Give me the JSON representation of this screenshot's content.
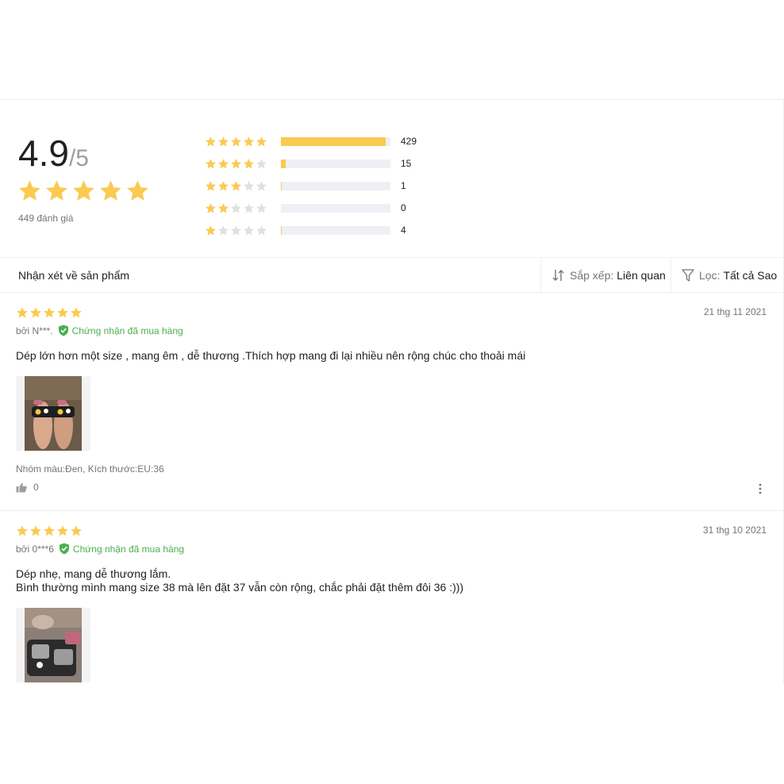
{
  "summary": {
    "score": "4.9",
    "score_max": "/5",
    "total_label": "449 đánh giá",
    "distribution": [
      {
        "stars": 5,
        "count": "429",
        "fill_fraction": 0.96
      },
      {
        "stars": 4,
        "count": "15",
        "fill_fraction": 0.04
      },
      {
        "stars": 3,
        "count": "1",
        "fill_fraction": 0.01
      },
      {
        "stars": 2,
        "count": "0",
        "fill_fraction": 0.0
      },
      {
        "stars": 1,
        "count": "4",
        "fill_fraction": 0.01
      }
    ]
  },
  "toolbar": {
    "title": "Nhận xét về sản phẩm",
    "sort_label": "Sắp xếp:",
    "sort_value": "Liên quan",
    "filter_label": "Lọc:",
    "filter_value": "Tất cả Sao"
  },
  "reviews": [
    {
      "rating": 5,
      "date": "21 thg 11 2021",
      "author": "bởi N***.",
      "verified_label": "Chứng nhận đã mua hàng",
      "text_lines": [
        "Dép lớn hơn một size , mang êm , dễ thương .Thích hợp mang đi lại nhiều nên rộng chúc cho thoải mái"
      ],
      "sku": "Nhóm màu:Đen, Kích thước:EU:36",
      "likes": "0"
    },
    {
      "rating": 5,
      "date": "31 thg 10 2021",
      "author": "bởi 0***6",
      "verified_label": "Chứng nhận đã mua hàng",
      "text_lines": [
        "Dép nhẹ, mang dễ thương lắm.",
        "Bình thường mình mang size 38 mà lên đặt 37 vẫn còn rộng, chắc phải đặt thêm đôi 36 :)))"
      ]
    }
  ],
  "colors": {
    "star": "#faca51",
    "star_empty": "#e0e0e0",
    "bar_bg": "#eff0f5",
    "verified": "#4caf50"
  },
  "icons": {
    "sort": "sort-icon",
    "filter": "filter-icon",
    "verified": "check-shield-icon",
    "like": "thumbs-up-icon",
    "more": "more-vertical-icon"
  }
}
